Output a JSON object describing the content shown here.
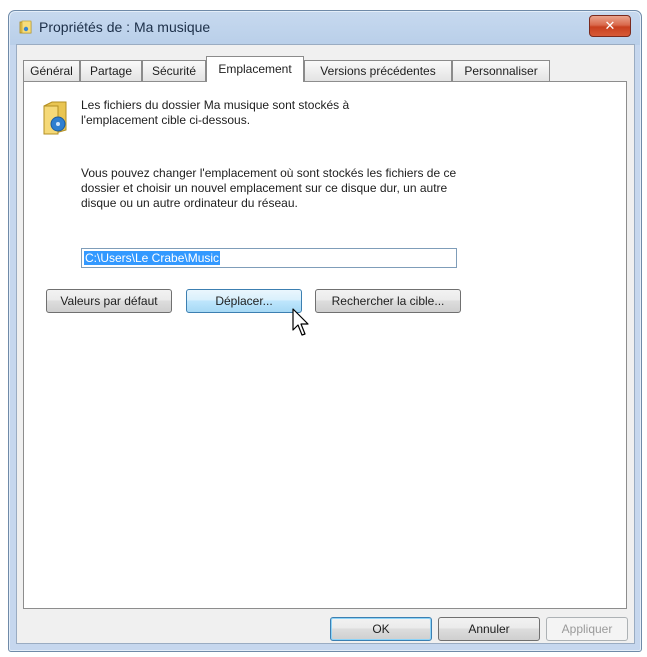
{
  "window": {
    "title": "Propriétés de : Ma musique",
    "close_label": "✕"
  },
  "tabs": [
    {
      "label": "Général"
    },
    {
      "label": "Partage"
    },
    {
      "label": "Sécurité"
    },
    {
      "label": "Emplacement"
    },
    {
      "label": "Versions précédentes"
    },
    {
      "label": "Personnaliser"
    }
  ],
  "active_tab": "Emplacement",
  "location": {
    "description": "Les fichiers du dossier Ma musique sont stockés à l'emplacement cible ci-dessous.",
    "help_text": "Vous pouvez changer l'emplacement où sont stockés les fichiers de ce dossier et choisir un nouvel emplacement sur ce disque dur, un autre disque ou un autre ordinateur du réseau.",
    "path_value": "C:\\Users\\Le Crabe\\Music",
    "restore_default_label": "Valeurs par défaut",
    "move_label": "Déplacer...",
    "find_target_label": "Rechercher la cible..."
  },
  "footer": {
    "ok_label": "OK",
    "cancel_label": "Annuler",
    "apply_label": "Appliquer"
  },
  "icons": {
    "title_icon": "folder-music-icon",
    "folder_icon": "music-folder-icon",
    "cursor": "mouse-pointer-icon"
  },
  "colors": {
    "titlebar": "#b9cfe9",
    "close_button": "#c8401f",
    "selection": "#3399ff"
  }
}
